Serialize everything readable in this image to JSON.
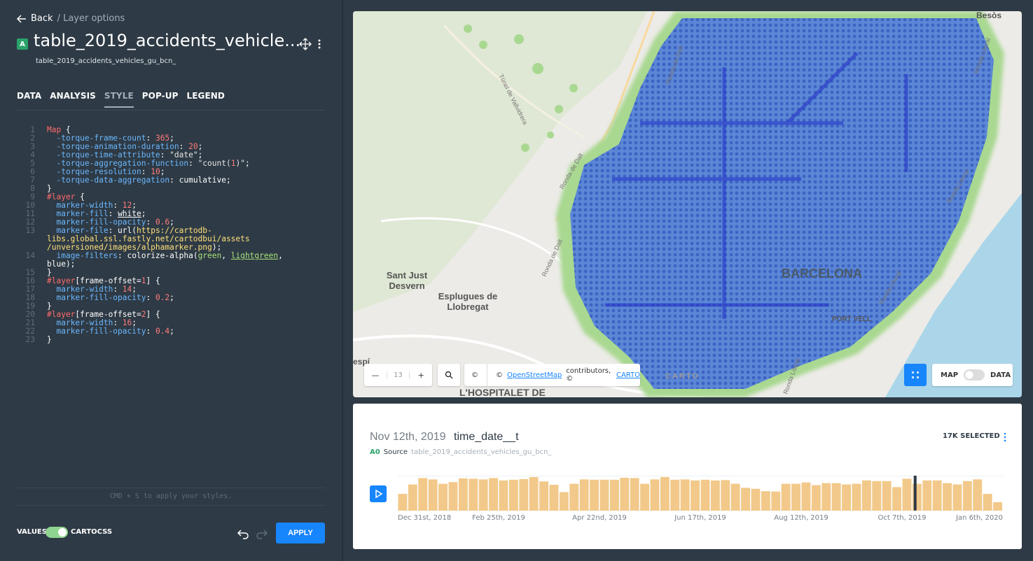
{
  "header": {
    "back_label": "Back",
    "breadcrumb": "/ Layer options",
    "layer_letter": "A",
    "layer_title": "table_2019_accidents_vehicle...",
    "layer_source": "table_2019_accidents_vehicles_gu_bcn_"
  },
  "tabs": [
    "DATA",
    "ANALYSIS",
    "STYLE",
    "POP-UP",
    "LEGEND"
  ],
  "active_tab": "STYLE",
  "editor": {
    "line_numbers": [
      "1",
      "2",
      "3",
      "4",
      "5",
      "6",
      "7",
      "8",
      "9",
      "10",
      "11",
      "12",
      "13",
      "",
      "",
      "14",
      "",
      "15",
      "16",
      "17",
      "18",
      "19",
      "20",
      "21",
      "22",
      "23"
    ],
    "hint": "CMD + S to apply your styles."
  },
  "footer": {
    "values_label": "VALUES",
    "cartocss_label": "CARTOCSS",
    "apply_label": "APPLY"
  },
  "map": {
    "labels": {
      "barcelona": "BARCELONA",
      "sant_just": "Sant Just\nDesvern",
      "esplugues": "Esplugues de\nLlobregat",
      "port_vell": "PORT VELL",
      "hospitalet": "L'HOSPITALET DE",
      "sant_adria": "Sant Adrià de\nBesòs",
      "espi": "espí",
      "tunnel": "Túnel de Vallvidrera",
      "ronda_dalt": "Ronda de Dalt",
      "ronda_litoral": "Ronda Litoral",
      "carto_logo": "CARTO"
    },
    "zoom_minus": "—",
    "zoom_level": "13",
    "zoom_plus": "+",
    "attribution_copy": "©",
    "attribution_prefix": "©",
    "attribution_osm": "OpenStreetMap",
    "attribution_mid": "contributors, ©",
    "attribution_carto": "CARTO",
    "toggle_map": "MAP",
    "toggle_data": "DATA"
  },
  "widget": {
    "date": "Nov 12th, 2019",
    "column": "time_date__t",
    "selected": "17K SELECTED",
    "source_id": "A0",
    "source_label": "Source",
    "source_name": "table_2019_accidents_vehicles_gu_bcn_",
    "x_labels": [
      "Dec 31st, 2018",
      "Feb 25th, 2019",
      "Apr 22nd, 2019",
      "Jun 17th, 2019",
      "Aug 12th, 2019",
      "Oct 7th, 2019",
      "Jan 6th, 2020"
    ],
    "playhead_fraction": 0.855,
    "bar_color": "#f2c98a"
  },
  "chart_data": {
    "type": "bar",
    "title": "",
    "xlabel": "",
    "ylabel": "",
    "values": [
      0.5,
      0.78,
      0.97,
      0.93,
      0.8,
      0.85,
      0.96,
      0.95,
      0.93,
      0.97,
      0.9,
      0.92,
      0.94,
      1.0,
      0.87,
      0.77,
      0.55,
      0.8,
      0.93,
      0.92,
      0.92,
      0.92,
      0.98,
      0.97,
      0.8,
      0.93,
      1.0,
      0.92,
      0.93,
      0.9,
      0.92,
      0.9,
      0.91,
      0.8,
      0.68,
      0.65,
      0.58,
      0.57,
      0.8,
      0.8,
      0.84,
      0.76,
      0.82,
      0.82,
      0.78,
      0.8,
      0.9,
      0.88,
      0.88,
      0.7,
      0.95,
      0.8,
      0.9,
      0.9,
      0.82,
      0.78,
      0.88,
      0.93,
      0.5,
      0.25
    ]
  }
}
